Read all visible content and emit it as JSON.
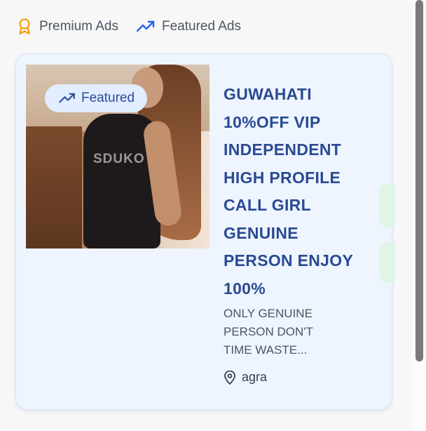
{
  "legend": {
    "premium_label": "Premium Ads",
    "featured_label": "Featured Ads",
    "premium_icon": "award-icon",
    "featured_icon": "trending-up-icon",
    "premium_color": "#f59e0b",
    "featured_color": "#2563eb"
  },
  "ad": {
    "badge_label": "Featured",
    "image_watermark": "SDUKO",
    "title": "GUWAHATI 10%OFF VIP INDEPENDENT HIGH PROFILE CALL GIRL GENUINE PERSON ENJOY 100%",
    "description": "ONLY GENUINE PERSON DON'T TIME WASTE...",
    "location": "agra",
    "title_color": "#2a4a93",
    "card_background": "#eef5ff"
  }
}
